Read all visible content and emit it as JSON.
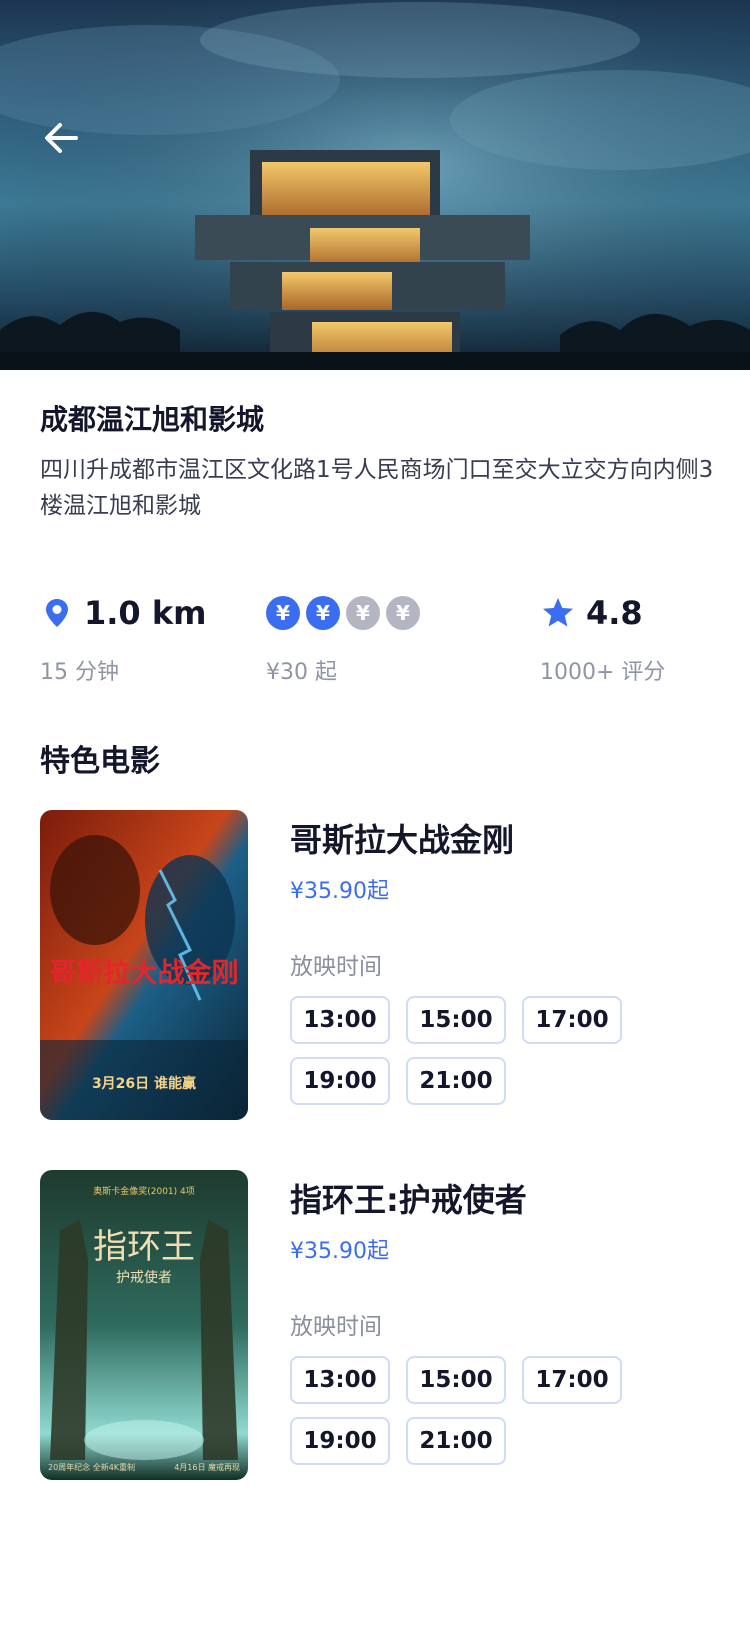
{
  "cinema": {
    "name": "成都温江旭和影城",
    "address": "四川升成都市温江区文化路1号人民商场门口至交大立交方向内侧3楼温江旭和影城"
  },
  "stats": {
    "distance": {
      "value": "1.0 km",
      "sub": "15 分钟",
      "icon": "location-pin-icon"
    },
    "price": {
      "symbol": "¥",
      "active_level": 2,
      "max_level": 4,
      "sub": "¥30 起"
    },
    "rating": {
      "value": "4.8",
      "sub": "1000+ 评分",
      "icon": "star-icon"
    }
  },
  "colors": {
    "accent": "#3a6df0",
    "inactive": "#b3b6c2",
    "chip_border": "#cfdcf5"
  },
  "section": {
    "title": "特色电影"
  },
  "movies": [
    {
      "title": "哥斯拉大战金刚",
      "price": "¥35.90起",
      "showtime_label": "放映时间",
      "poster_title": "哥斯拉大战金刚",
      "poster_date": "3月26日 谁能赢",
      "times": [
        "13:00",
        "15:00",
        "17:00",
        "19:00",
        "21:00"
      ]
    },
    {
      "title": "指环王:护戒使者",
      "price": "¥35.90起",
      "showtime_label": "放映时间",
      "poster_title": "指环王",
      "poster_subtitle": "护戒使者",
      "poster_badge": "奥斯卡金像奖(2001) 4项",
      "poster_footer_left": "20周年纪念 全新4K重制",
      "poster_footer_right": "4月16日 魔戒再现",
      "times": [
        "13:00",
        "15:00",
        "17:00",
        "19:00",
        "21:00"
      ]
    }
  ]
}
